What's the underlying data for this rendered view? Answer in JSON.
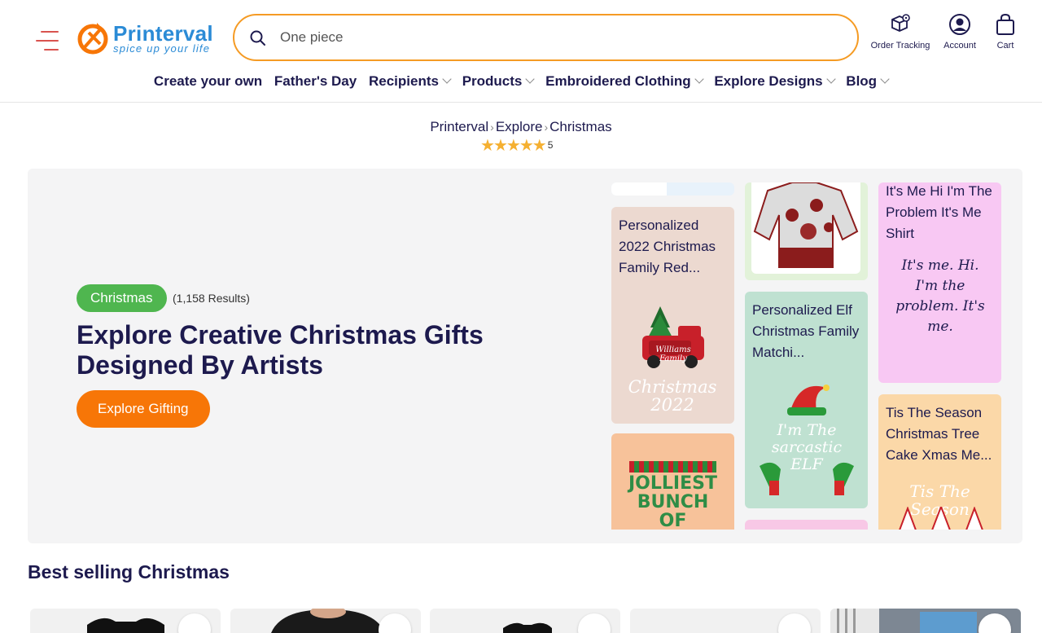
{
  "brand": {
    "name": "Printerval",
    "tagline": "spice up your life",
    "accent": "#f77607",
    "primary": "#2b8bd6"
  },
  "search": {
    "placeholder": "One piece"
  },
  "header_actions": [
    {
      "label": "Order Tracking",
      "icon": "package-location-icon"
    },
    {
      "label": "Account",
      "icon": "user-icon"
    },
    {
      "label": "Cart",
      "icon": "shopping-bag-icon"
    }
  ],
  "nav": [
    {
      "label": "Create your own",
      "dropdown": false
    },
    {
      "label": "Father's Day",
      "dropdown": false
    },
    {
      "label": "Recipients",
      "dropdown": true
    },
    {
      "label": "Products",
      "dropdown": true
    },
    {
      "label": "Embroidered Clothing",
      "dropdown": true
    },
    {
      "label": "Explore Designs",
      "dropdown": true
    },
    {
      "label": "Blog",
      "dropdown": true
    }
  ],
  "breadcrumb": [
    "Printerval",
    "Explore",
    "Christmas"
  ],
  "rating": {
    "stars": 5,
    "value": "5"
  },
  "hero": {
    "tag": "Christmas",
    "results": "(1,158 Results)",
    "title": "Explore Creative Christmas Gifts Designed By Artists",
    "cta": "Explore Gifting"
  },
  "gallery": [
    {
      "title": "Personalized 2022 Christmas Family Red...",
      "color": "#ecd9d0",
      "art_text": "Christmas 2022",
      "art_banner": "Williams Family"
    },
    {
      "title": "",
      "color": "#f7c29a",
      "art_text": "JOLLIEST BUNCH OF ASSHOLES"
    },
    {
      "title": "",
      "color": "#e2f2d9"
    },
    {
      "title": "Personalized Elf Christmas Family Matchi...",
      "color": "#bfe1d1",
      "art_text": "I'm The sarcastic ELF"
    },
    {
      "title": "It's Me Hi I'm The Problem It's Me Shirt",
      "color": "#f8c8f3",
      "art_text": "It's me. Hi. I'm the problem. It's me."
    },
    {
      "title": "Tis The Season Christmas Tree Cake Xmas Me...",
      "color": "#fbd8a8",
      "art_text": "Tis The Season"
    }
  ],
  "best_selling": {
    "title": "Best selling Christmas"
  }
}
